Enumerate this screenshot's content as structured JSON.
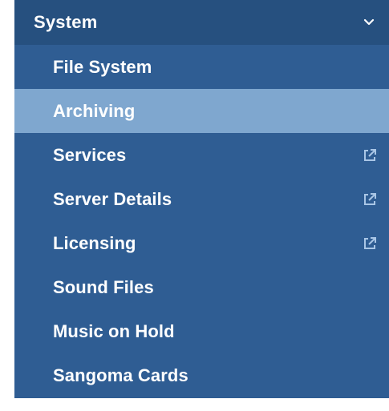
{
  "menu": {
    "header": {
      "label": "System",
      "icon": "chevron-down-icon"
    },
    "items": [
      {
        "label": "File System",
        "active": false,
        "external": false
      },
      {
        "label": "Archiving",
        "active": true,
        "external": false
      },
      {
        "label": "Services",
        "active": false,
        "external": true
      },
      {
        "label": "Server Details",
        "active": false,
        "external": true
      },
      {
        "label": "Licensing",
        "active": false,
        "external": true
      },
      {
        "label": "Sound Files",
        "active": false,
        "external": false
      },
      {
        "label": "Music on Hold",
        "active": false,
        "external": false
      },
      {
        "label": "Sangoma Cards",
        "active": false,
        "external": false
      }
    ]
  },
  "colors": {
    "menu_bg": "#2f5d93",
    "header_bg": "#26507f",
    "active_bg": "#7fa7cf",
    "text": "#ffffff",
    "icon": "#a9c6e6"
  }
}
